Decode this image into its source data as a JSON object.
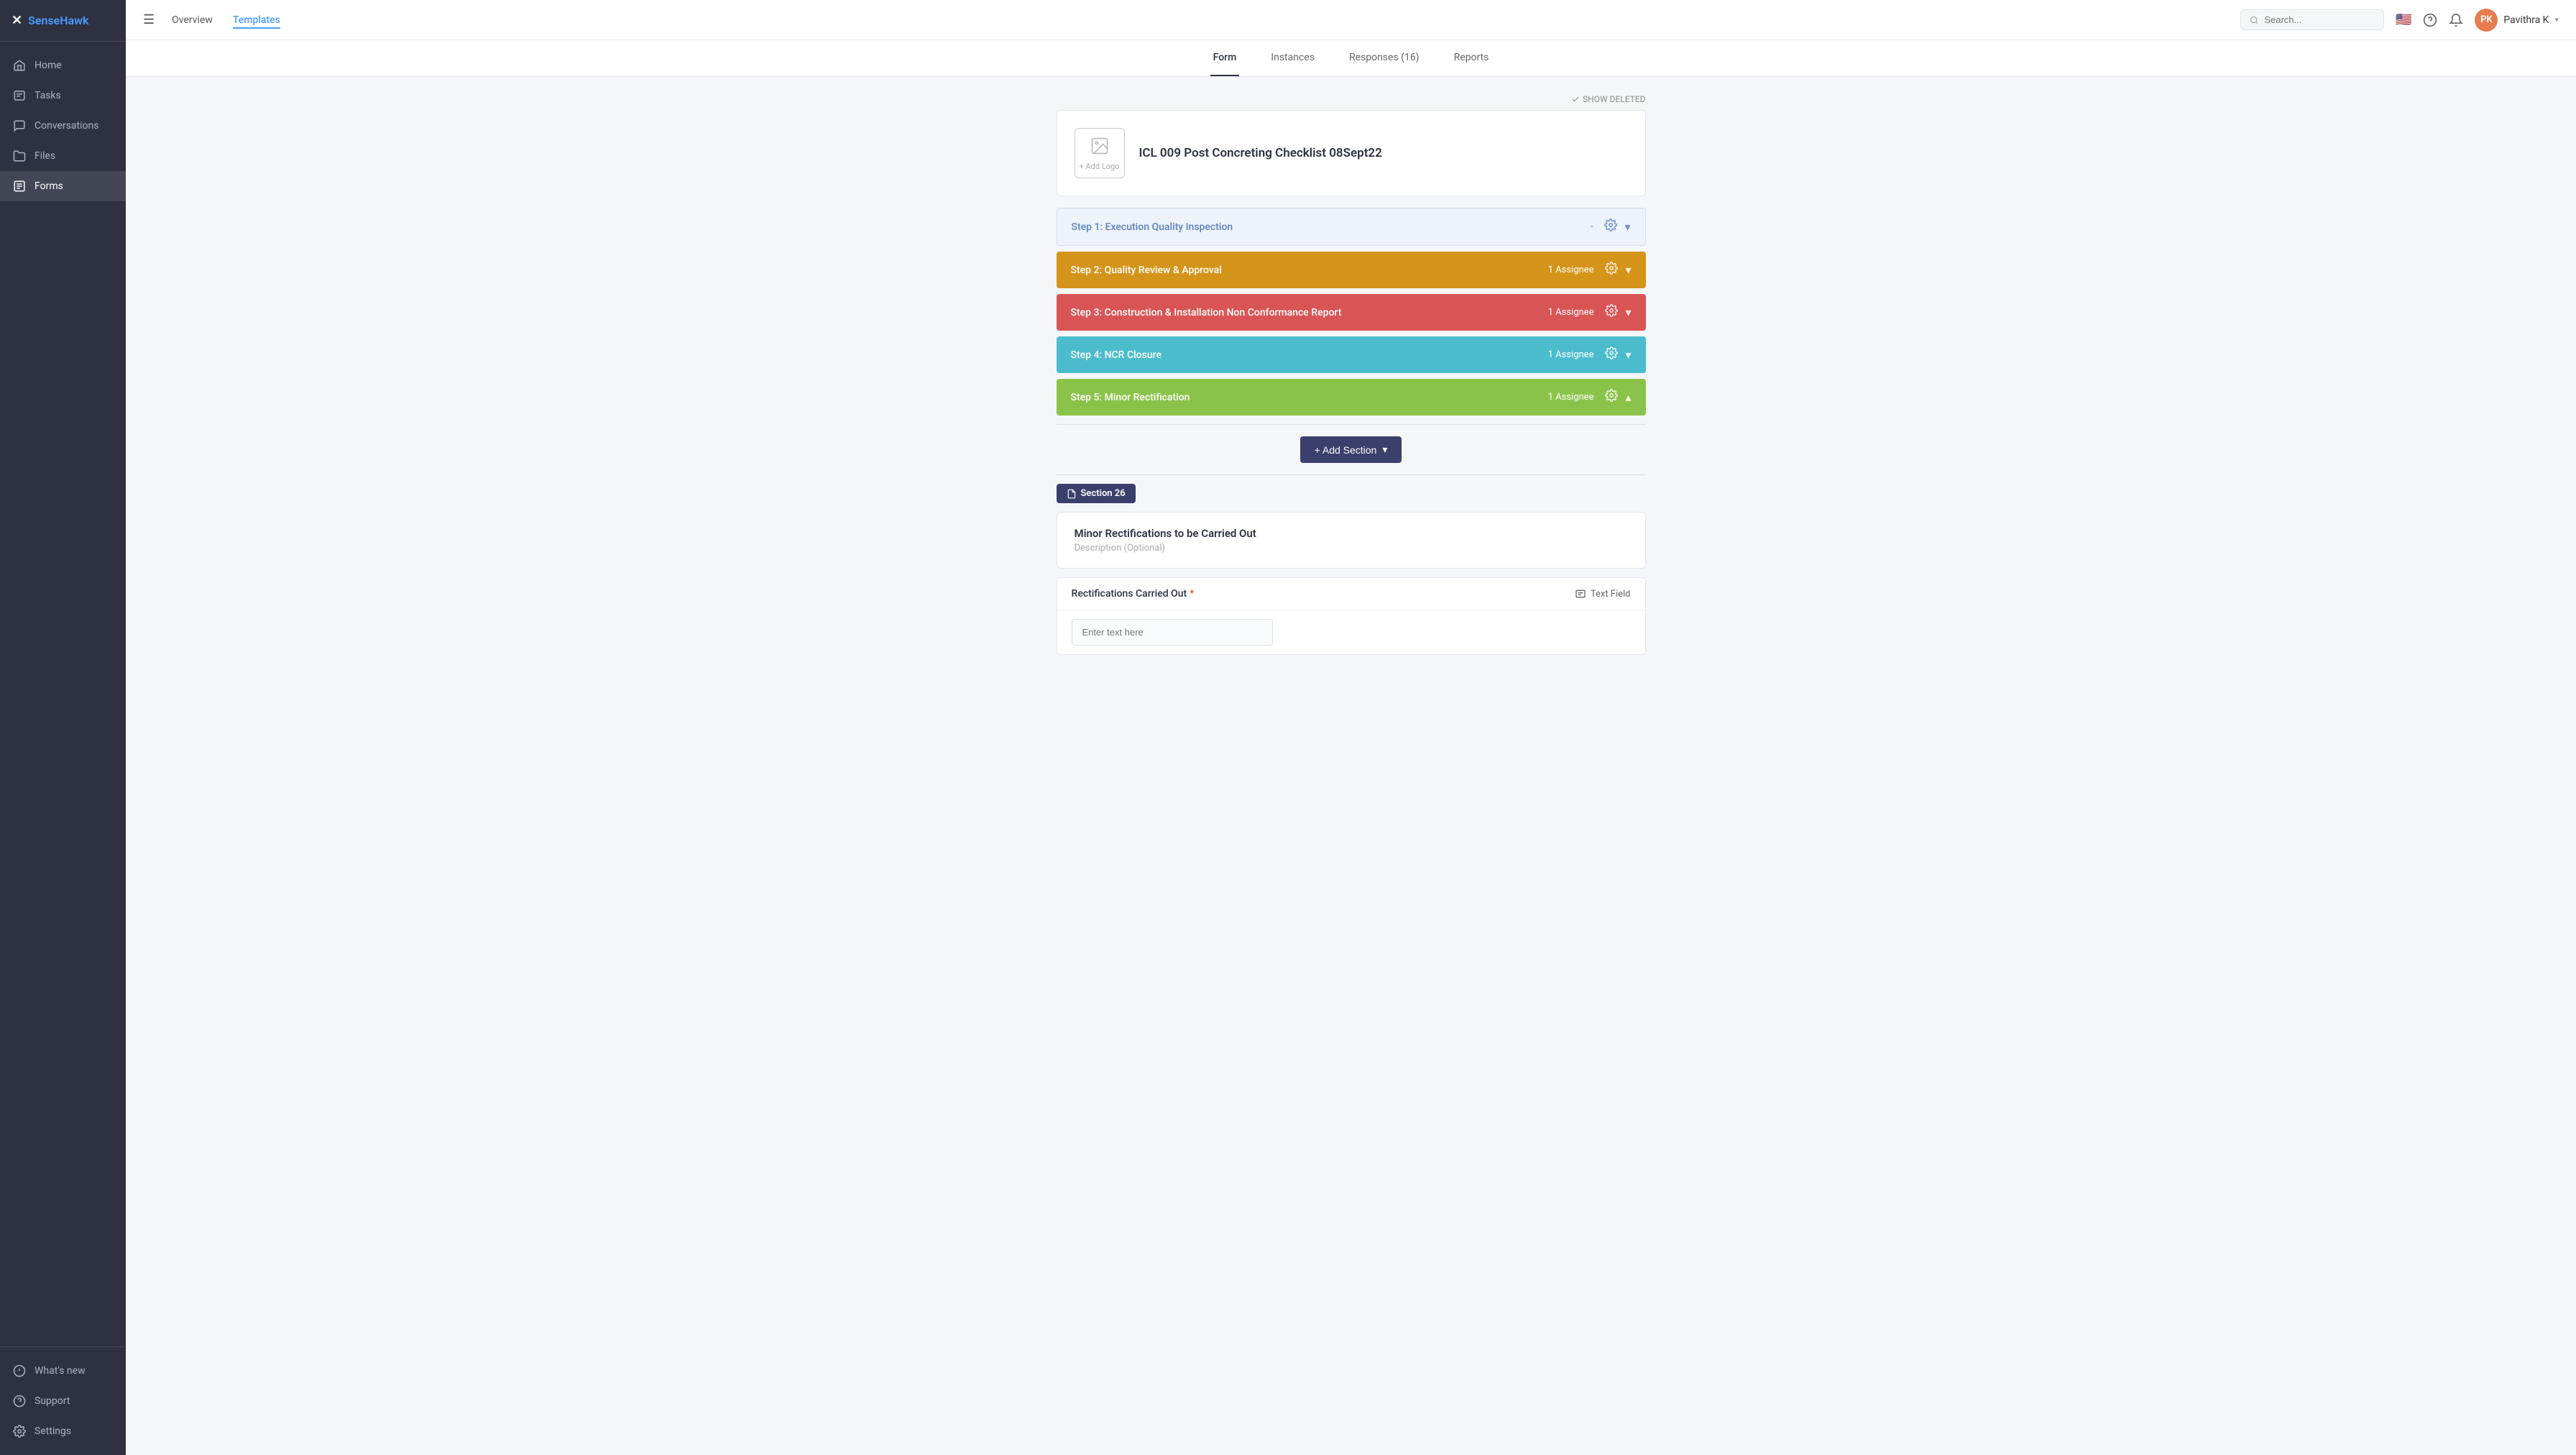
{
  "app": {
    "name_part1": "Sense",
    "name_part2": "Hawk"
  },
  "sidebar": {
    "nav_items": [
      {
        "id": "home",
        "label": "Home",
        "active": false
      },
      {
        "id": "tasks",
        "label": "Tasks",
        "active": false
      },
      {
        "id": "conversations",
        "label": "Conversations",
        "active": false
      },
      {
        "id": "files",
        "label": "Files",
        "active": false
      },
      {
        "id": "forms",
        "label": "Forms",
        "active": true
      }
    ],
    "bottom_items": [
      {
        "id": "whats-new",
        "label": "What's new",
        "active": false
      },
      {
        "id": "support",
        "label": "Support",
        "active": false
      },
      {
        "id": "settings",
        "label": "Settings",
        "active": false
      }
    ]
  },
  "topbar": {
    "menu_icon": "☰",
    "tabs": [
      {
        "id": "overview",
        "label": "Overview",
        "active": false
      },
      {
        "id": "templates",
        "label": "Templates",
        "active": true
      }
    ],
    "search_placeholder": "Search...",
    "user_name": "Pavithra K",
    "user_initials": "PK",
    "chevron": "▾"
  },
  "content_tabs": [
    {
      "id": "form",
      "label": "Form",
      "active": true
    },
    {
      "id": "instances",
      "label": "Instances",
      "active": false
    },
    {
      "id": "responses",
      "label": "Responses (16)",
      "active": false
    },
    {
      "id": "reports",
      "label": "Reports",
      "active": false
    }
  ],
  "show_deleted_label": "SHOW DELETED",
  "form_header": {
    "title": "ICL 009 Post Concreting Checklist 08Sept22",
    "add_logo_label": "+ Add Logo"
  },
  "steps": [
    {
      "id": "step1",
      "label": "Step 1:  Execution Quality Inspection",
      "assignee": "",
      "color_class": "step-1",
      "dash": "-"
    },
    {
      "id": "step2",
      "label": "Step 2:  Quality Review & Approval",
      "assignee": "1 Assignee",
      "color_class": "step-2"
    },
    {
      "id": "step3",
      "label": "Step 3:  Construction & Installation Non Conformance Report",
      "assignee": "1 Assignee",
      "color_class": "step-3"
    },
    {
      "id": "step4",
      "label": "Step 4:  NCR Closure",
      "assignee": "1 Assignee",
      "color_class": "step-4"
    },
    {
      "id": "step5",
      "label": "Step 5:  Minor Rectification",
      "assignee": "1 Assignee",
      "color_class": "step-5"
    }
  ],
  "add_section": {
    "label": "+ Add Section",
    "chevron": "▾"
  },
  "section26": {
    "badge_label": "Section 26",
    "card_title": "Minor Rectifications to be Carried Out",
    "card_description": "Description (Optional)"
  },
  "fields": [
    {
      "name": "Rectifications Carried Out",
      "required": true,
      "type_label": "Text Field",
      "input_placeholder": "Enter text here"
    }
  ]
}
